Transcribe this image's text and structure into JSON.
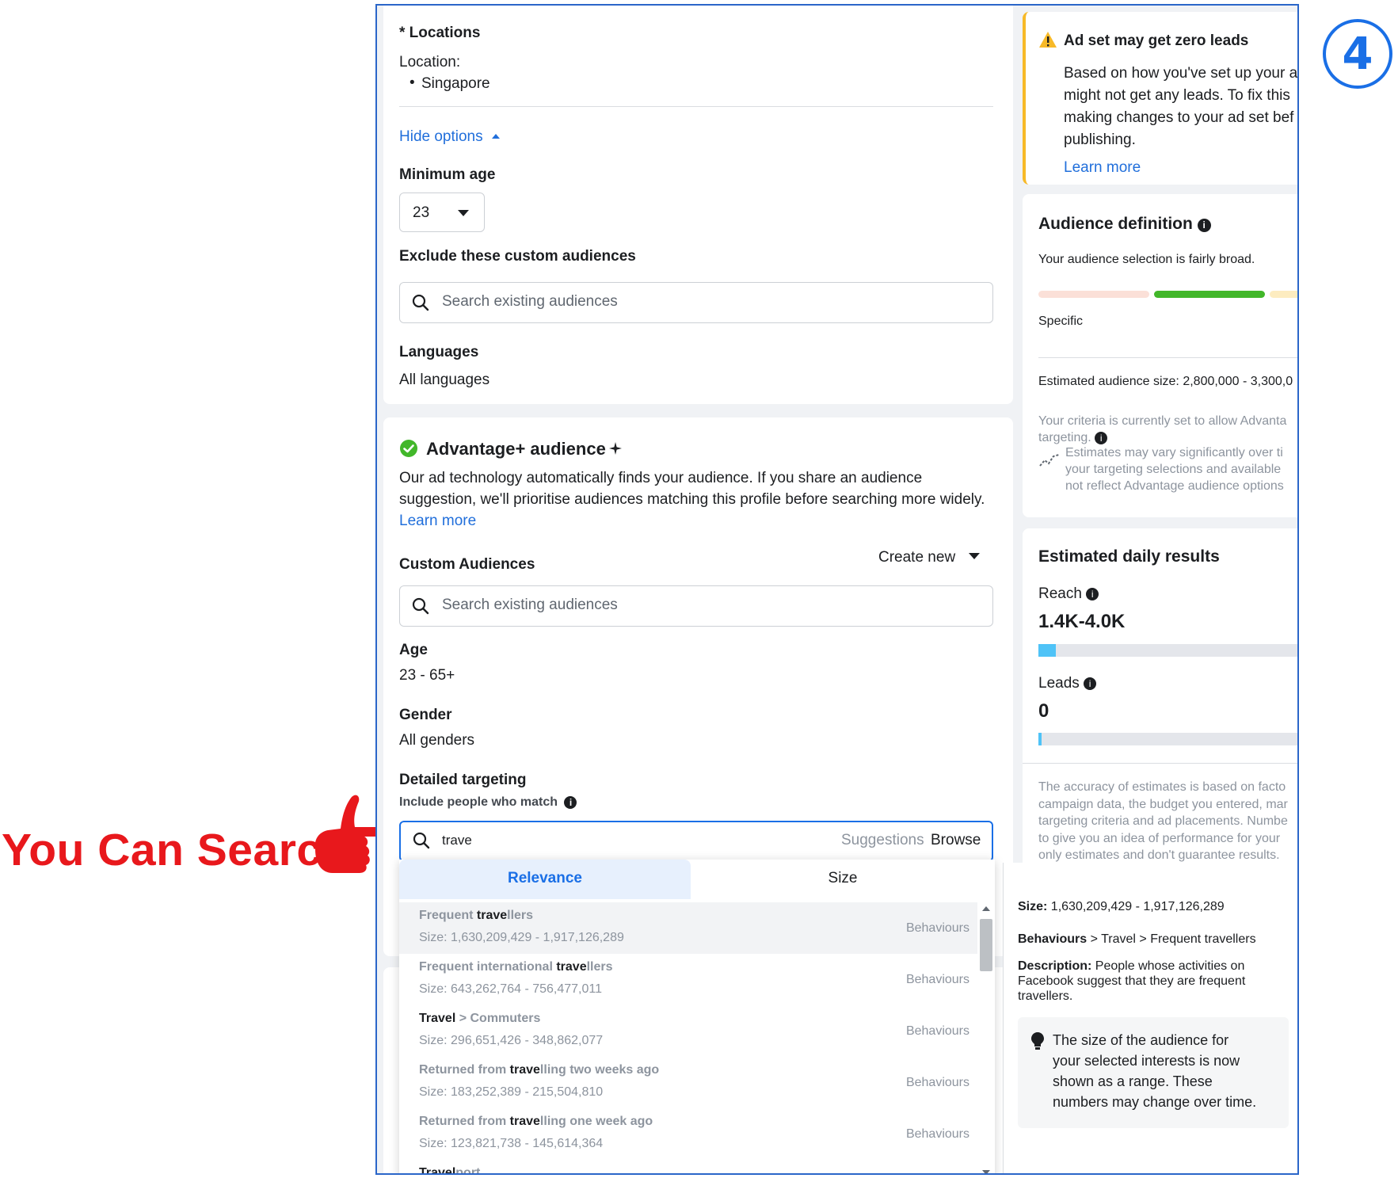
{
  "annotation": {
    "callout_text": "You Can Search",
    "step_number": "4"
  },
  "locations": {
    "title": "* Locations",
    "location_label": "Location:",
    "location_value": "Singapore",
    "hide_options": "Hide options"
  },
  "minimum_age": {
    "label": "Minimum age",
    "value": "23"
  },
  "exclude": {
    "label": "Exclude these custom audiences",
    "placeholder": "Search existing audiences"
  },
  "languages": {
    "label": "Languages",
    "value": "All languages"
  },
  "advantage": {
    "title": "Advantage+ audience",
    "description_line1": "Our ad technology automatically finds your audience. If you share an audience",
    "description_line2": "suggestion, we'll prioritise audiences matching this profile before searching more widely.",
    "learn_more": "Learn more",
    "custom_audiences_label": "Custom Audiences",
    "create_new": "Create new",
    "custom_placeholder": "Search existing audiences",
    "age_label": "Age",
    "age_value": "23 - 65+",
    "gender_label": "Gender",
    "gender_value": "All genders",
    "detailed_label": "Detailed targeting",
    "include_label": "Include people who match",
    "search_value": "trave",
    "suggestions": "Suggestions",
    "browse": "Browse"
  },
  "dropdown": {
    "tab_relevance": "Relevance",
    "tab_size": "Size",
    "results": [
      {
        "name_pre": "Frequent ",
        "name_match": "trave",
        "name_post": "llers",
        "size": "Size: 1,630,209,429 - 1,917,126,289",
        "category": "Behaviours"
      },
      {
        "name_pre": "Frequent international ",
        "name_match": "trave",
        "name_post": "llers",
        "size": "Size: 643,262,764 - 756,477,011",
        "category": "Behaviours"
      },
      {
        "name_pre": "",
        "name_match": "Travel",
        "name_post": " > Commuters",
        "size": "Size: 296,651,426 - 348,862,077",
        "category": "Behaviours"
      },
      {
        "name_pre": "Returned from ",
        "name_match": "trave",
        "name_post": "lling two weeks ago",
        "size": "Size: 183,252,389 - 215,504,810",
        "category": "Behaviours"
      },
      {
        "name_pre": "Returned from ",
        "name_match": "trave",
        "name_post": "lling one week ago",
        "size": "Size: 123,821,738 - 145,614,364",
        "category": "Behaviours"
      },
      {
        "name_pre": "",
        "name_match": "Travel",
        "name_post": "port",
        "size": "",
        "category": ""
      }
    ]
  },
  "detail": {
    "size_label": "Size:",
    "size_value": "1,630,209,429 - 1,917,126,289",
    "path_bold": "Behaviours",
    "path_rest": "> Travel > Frequent travellers",
    "description_label": "Description:",
    "description_line1": "People whose activities on",
    "description_line2": "Facebook suggest that they are frequent",
    "description_line3": "travellers.",
    "tip_line1": "The size of the audience for",
    "tip_line2": "your selected interests is now",
    "tip_line3": "shown as a range. These",
    "tip_line4": "numbers may change over time."
  },
  "warning": {
    "title": "Ad set may get zero leads",
    "line1": "Based on how you've set up your a",
    "line2": "might not get any leads. To fix this",
    "line3": "making changes to your ad set bef",
    "line4": "publishing.",
    "learn_more": "Learn more"
  },
  "audience_definition": {
    "title": "Audience definition",
    "subtitle": "Your audience selection is fairly broad.",
    "specific": "Specific",
    "estimated_size": "Estimated audience size: 2,800,000 - 3,300,0",
    "criteria_line1": "Your criteria is currently set to allow Advanta",
    "criteria_line2": "targeting.",
    "estimates_line1": "Estimates may vary significantly over ti",
    "estimates_line2": "your targeting selections and available",
    "estimates_line3": "not reflect Advantage audience options"
  },
  "daily_results": {
    "title": "Estimated daily results",
    "reach_label": "Reach",
    "reach_value": "1.4K-4.0K",
    "leads_label": "Leads",
    "leads_value": "0",
    "accuracy_line1": "The accuracy of estimates is based on facto",
    "accuracy_line2": "campaign data, the budget you entered, mar",
    "accuracy_line3": "targeting criteria and ad placements. Numbe",
    "accuracy_line4": "to give you an idea of performance for your",
    "accuracy_line5": "only estimates and don't guarantee results."
  },
  "colors": {
    "accent": "#1a6fe6",
    "annotation_red": "#e8181c",
    "warning_yellow": "#f7b928",
    "success_green": "#42b72a",
    "reach_bar": "#4fc3f7"
  }
}
